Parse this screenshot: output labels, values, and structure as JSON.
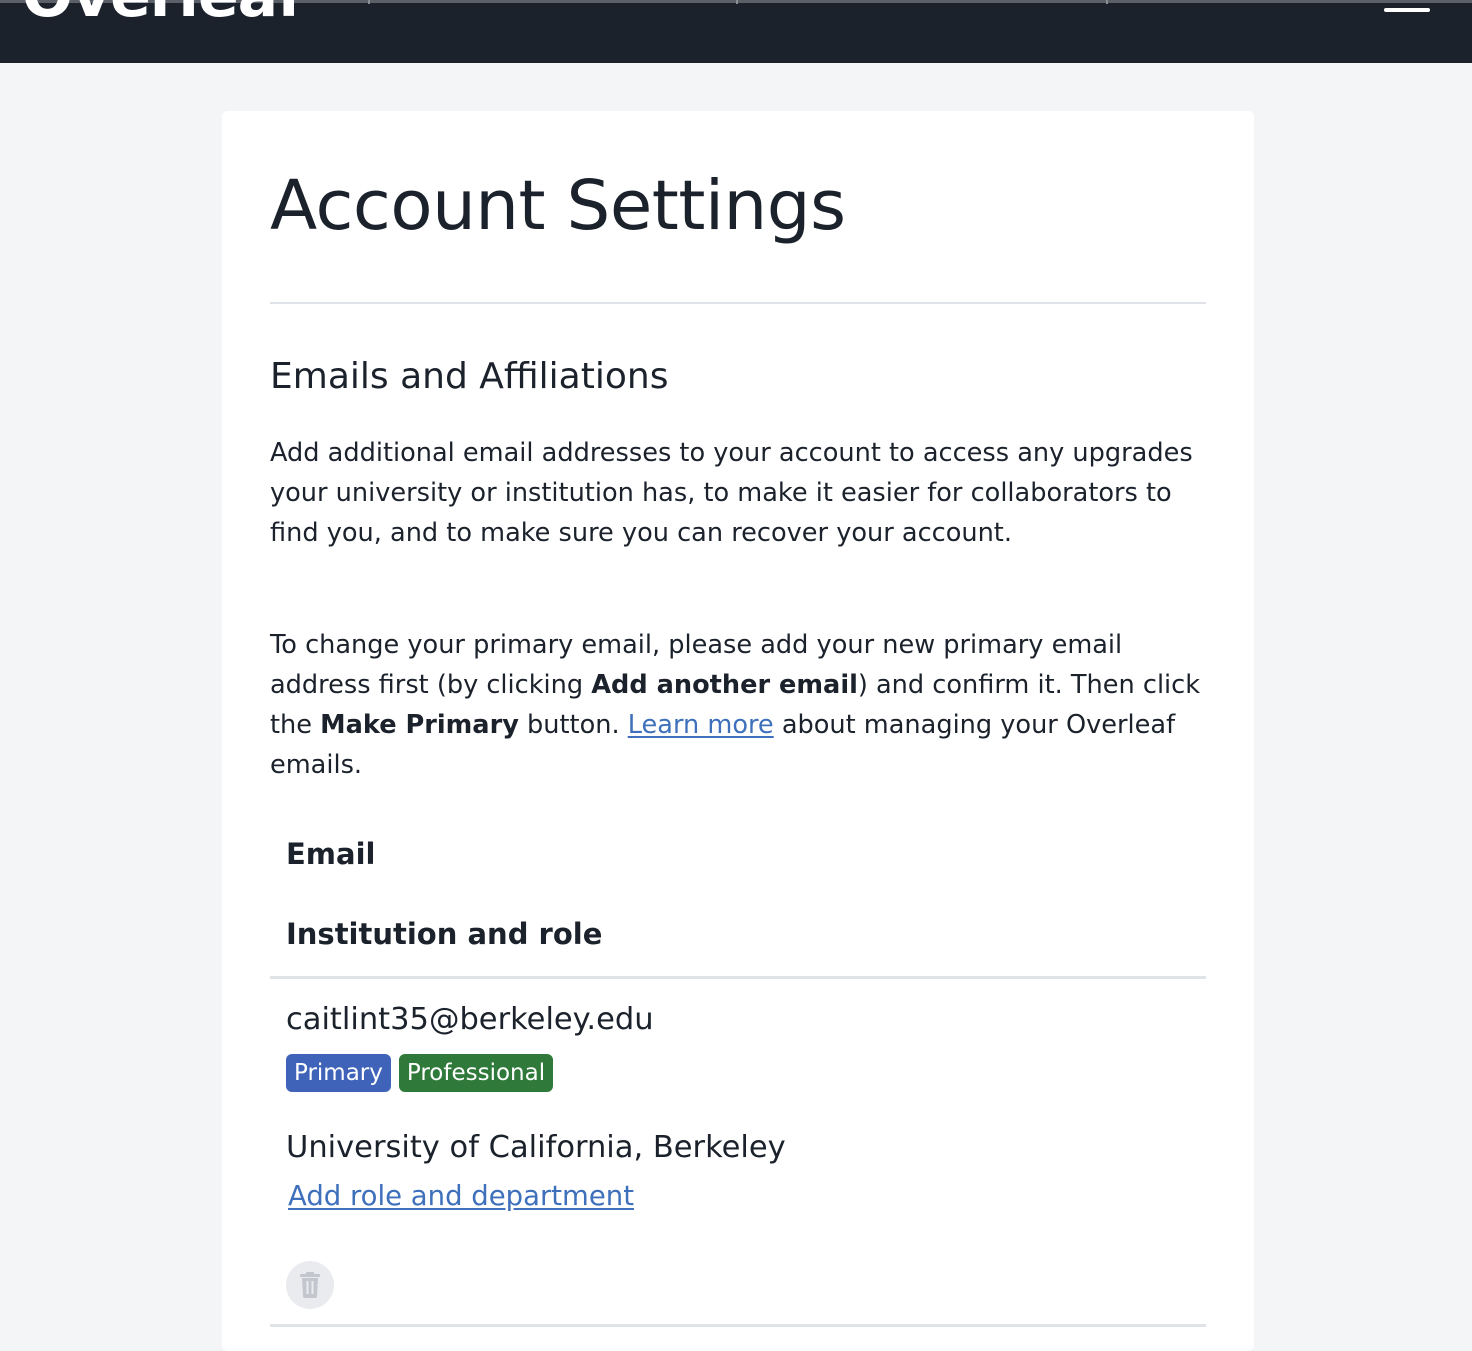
{
  "header": {
    "logo_text": "Overleaf",
    "menu_icon": "hamburger-menu-icon"
  },
  "page": {
    "title": "Account Settings"
  },
  "emails_section": {
    "title": "Emails and Affiliations",
    "intro": "Add additional email addresses to your account to access any upgrades your university or institution has, to make it easier for collaborators to find you, and to make sure you can recover your account.",
    "change_primary": {
      "part1": "To change your primary email, please add your new primary email address first (by clicking ",
      "bold1": "Add another email",
      "part2": ") and confirm it. Then click the ",
      "bold2": "Make Primary",
      "part3": " button. ",
      "link_text": "Learn more",
      "part4": " about managing your Overleaf emails."
    },
    "table": {
      "col_email": "Email",
      "col_institution": "Institution and role",
      "rows": [
        {
          "email": "caitlint35@berkeley.edu",
          "badges": [
            "Primary",
            "Professional"
          ],
          "institution": "University of California, Berkeley",
          "add_role_link": "Add role and department",
          "delete_icon": "trash-icon"
        }
      ]
    }
  },
  "colors": {
    "navbar_bg": "#1b222c",
    "page_bg": "#f4f5f6",
    "link": "#3e70bb",
    "badge_primary": "#3e63b8",
    "badge_professional": "#2f7a3a"
  }
}
